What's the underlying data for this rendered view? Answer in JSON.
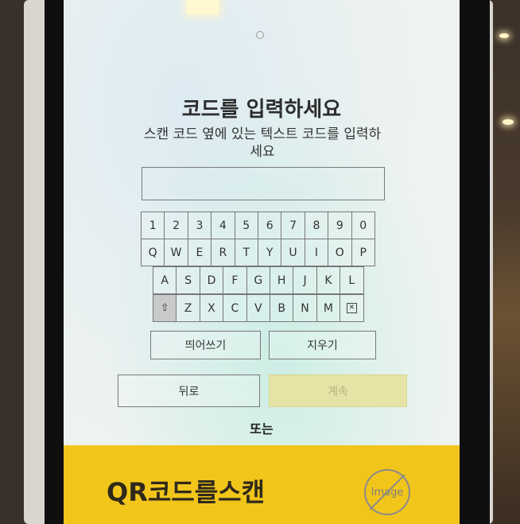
{
  "screen": {
    "title": "코드를 입력하세요",
    "subtitle": "스캔 코드 옆에 있는 텍스트 코드를 입력하세요",
    "code_input_value": "",
    "keyboard": {
      "row1": [
        "1",
        "2",
        "3",
        "4",
        "5",
        "6",
        "7",
        "8",
        "9",
        "0"
      ],
      "row2": [
        "Q",
        "W",
        "E",
        "R",
        "T",
        "Y",
        "U",
        "I",
        "O",
        "P"
      ],
      "row3": [
        "A",
        "S",
        "D",
        "F",
        "G",
        "H",
        "J",
        "K",
        "L"
      ],
      "row4_letters": [
        "Z",
        "X",
        "C",
        "V",
        "B",
        "N",
        "M"
      ],
      "shift_icon": "shift-icon",
      "backspace_icon": "backspace-icon"
    },
    "space_label": "띄어쓰기",
    "delete_label": "지우기",
    "back_label": "뒤로",
    "continue_label": "계속",
    "or_label": "또는",
    "qr_label": "QR코드를스캔",
    "image_placeholder_label": "Image"
  },
  "colors": {
    "banner": "#f2c51b",
    "continue_disabled": "#e6e3a7",
    "shift_key": "#c9cbc9"
  }
}
